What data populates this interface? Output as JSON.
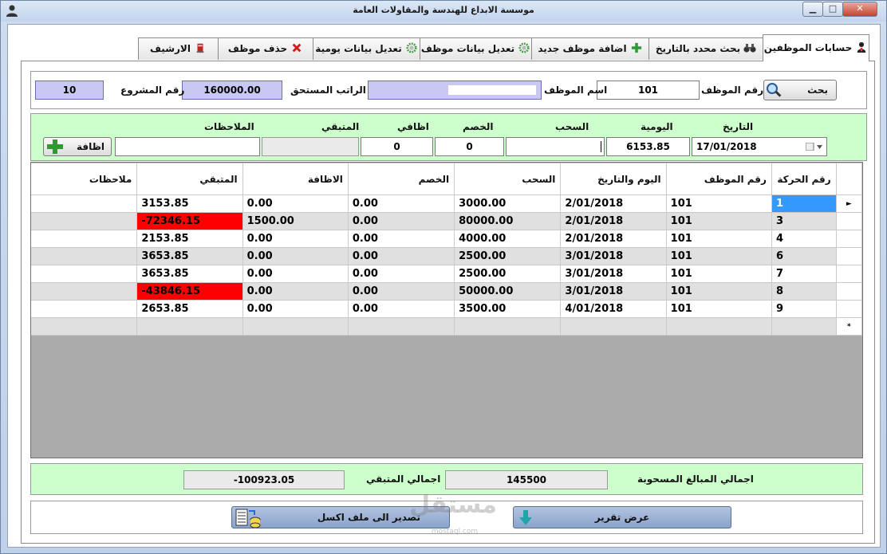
{
  "window": {
    "title": "موسسة الابداع للهندسة والمقاولات العامة",
    "min_glyph": "▁",
    "max_glyph": "□",
    "close_glyph": "✕"
  },
  "tabs": [
    {
      "label": "حسابات الموظفين",
      "icon": "user-icon",
      "active": true
    },
    {
      "label": "بحث محدد بالتاريخ",
      "icon": "binoculars-icon",
      "active": false
    },
    {
      "label": "اضافة موظف جديد",
      "icon": "plus-icon",
      "active": false
    },
    {
      "label": "تعديل بيانات موظف",
      "icon": "gear-icon",
      "active": false
    },
    {
      "label": "تعديل بيانات يومية",
      "icon": "gear-icon",
      "active": false
    },
    {
      "label": "حذف موظف",
      "icon": "delete-icon",
      "active": false
    },
    {
      "label": "الارشيف",
      "icon": "archive-icon",
      "active": false
    }
  ],
  "employee": {
    "search_button": "بحث",
    "id_label": "رقم الموظف",
    "id_value": "101",
    "name_label": "اسم الموظف",
    "salary_label": "الراتب المستحق",
    "salary_value": "160000.00",
    "project_label": "رقم المشروع",
    "project_value": "10"
  },
  "entry": {
    "date_label": "التاريخ",
    "date_value": "17/01/2018",
    "daily_label": "اليومية",
    "daily_value": "6153.85",
    "withdraw_label": "السحب",
    "withdraw_value": "",
    "discount_label": "الخصم",
    "discount_value": "0",
    "extra_label": "اظافي",
    "extra_value": "0",
    "remaining_label": "المتبقي",
    "remaining_value": "",
    "notes_label": "الملاحظات",
    "notes_value": "",
    "add_button": "اظافة"
  },
  "grid": {
    "columns": [
      "رقم الحركة",
      "رقم الموظف",
      "اليوم والتاريخ",
      "السحب",
      "الخصم",
      "الاظافة",
      "المتبقي",
      "ملاحظات"
    ],
    "rows": [
      [
        "1",
        "101",
        "2/01/2018",
        "3000.00",
        "0.00",
        "0.00",
        "3153.85",
        ""
      ],
      [
        "3",
        "101",
        "2/01/2018",
        "80000.00",
        "0.00",
        "1500.00",
        "-72346.15",
        ""
      ],
      [
        "4",
        "101",
        "2/01/2018",
        "4000.00",
        "0.00",
        "0.00",
        "2153.85",
        ""
      ],
      [
        "6",
        "101",
        "3/01/2018",
        "2500.00",
        "0.00",
        "0.00",
        "3653.85",
        ""
      ],
      [
        "7",
        "101",
        "3/01/2018",
        "2500.00",
        "0.00",
        "0.00",
        "3653.85",
        ""
      ],
      [
        "8",
        "101",
        "3/01/2018",
        "50000.00",
        "0.00",
        "0.00",
        "-43846.15",
        ""
      ],
      [
        "9",
        "101",
        "4/01/2018",
        "3500.00",
        "0.00",
        "0.00",
        "2653.85",
        ""
      ]
    ],
    "current_row_marker": "►",
    "new_row_marker": "*",
    "negative_color": "#ff0000",
    "selected_color": "#3399ff"
  },
  "totals": {
    "withdrawn_label": "اجمالي المبالغ المسحوبة",
    "withdrawn_value": "145500",
    "remaining_label": "اجمالي المتبقي",
    "remaining_value": "-100923.05"
  },
  "actions": {
    "report_button": "عرض تقرير",
    "export_button": "تصدير الى ملف اكسل"
  },
  "watermark": {
    "text": "مستقل",
    "sub": "mostaql.com"
  },
  "colors": {
    "panel_green": "#ccffcc",
    "field_blue": "#c8c8f2"
  }
}
